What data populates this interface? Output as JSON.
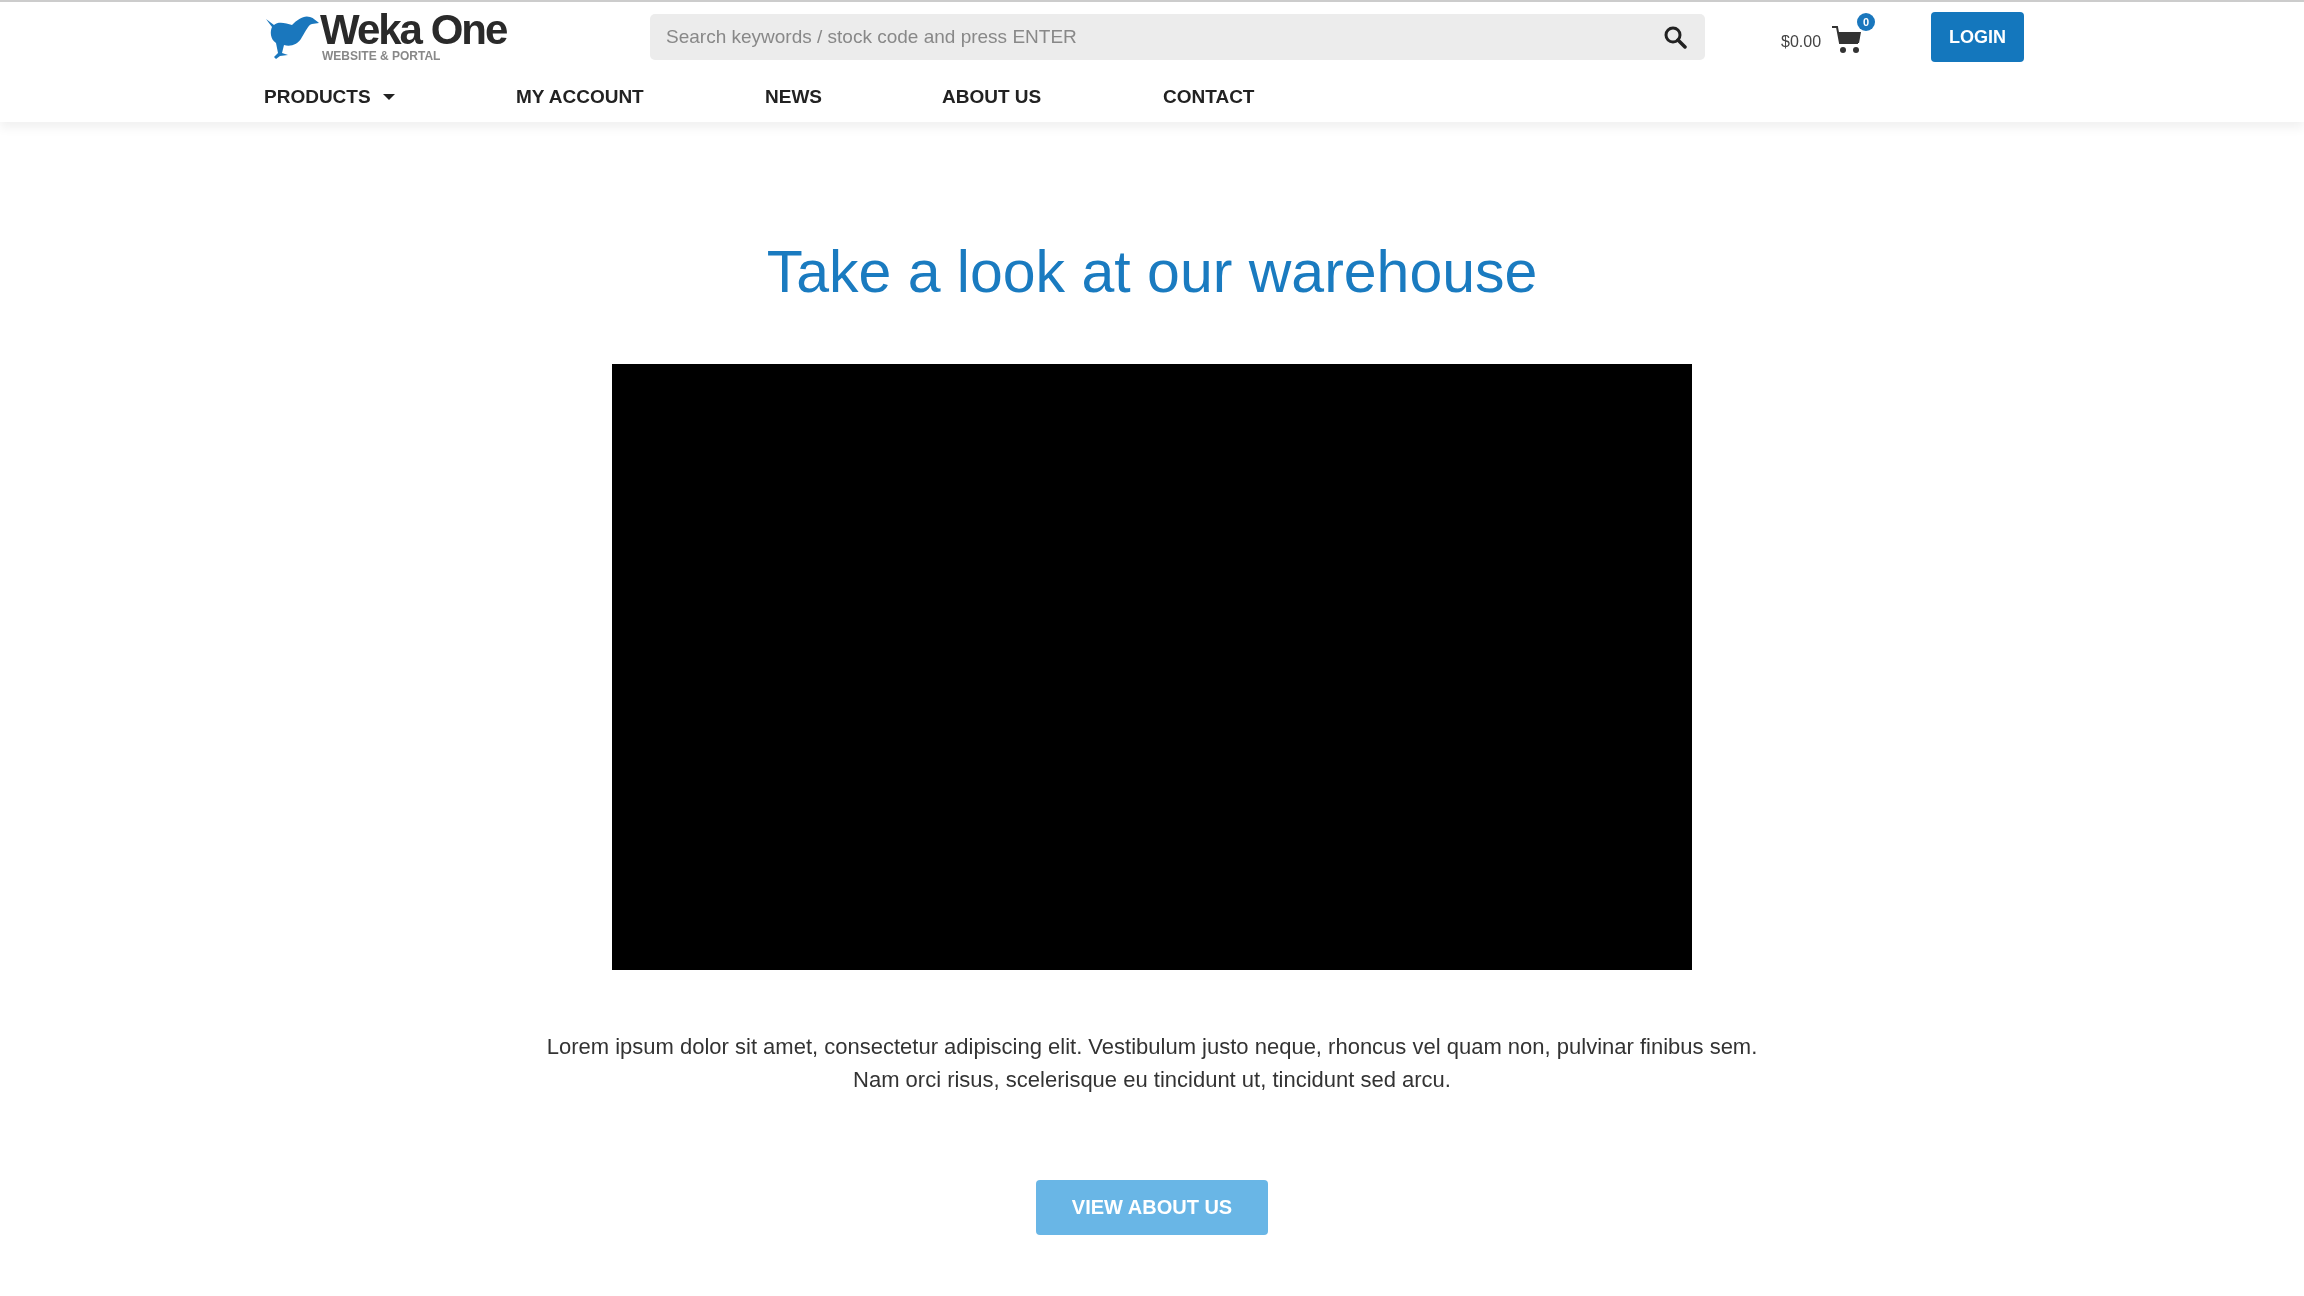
{
  "logo": {
    "name": "Weka One",
    "tagline": "WEBSITE & PORTAL"
  },
  "search": {
    "placeholder": "Search keywords / stock code and press ENTER"
  },
  "cart": {
    "total": "$0.00",
    "count": "0"
  },
  "login_button": "LOGIN",
  "nav": [
    {
      "label": "PRODUCTS",
      "has_dropdown": true
    },
    {
      "label": "MY ACCOUNT",
      "has_dropdown": false
    },
    {
      "label": "NEWS",
      "has_dropdown": false
    },
    {
      "label": "ABOUT US",
      "has_dropdown": false
    },
    {
      "label": "CONTACT",
      "has_dropdown": false
    }
  ],
  "heading": "Take a look at our warehouse",
  "paragraph": "Lorem ipsum dolor sit amet, consectetur adipiscing elit. Vestibulum justo neque, rhoncus vel quam non, pulvinar finibus sem. Nam orci risus, scelerisque eu tincidunt ut, tincidunt sed arcu.",
  "cta_button": "VIEW ABOUT US"
}
